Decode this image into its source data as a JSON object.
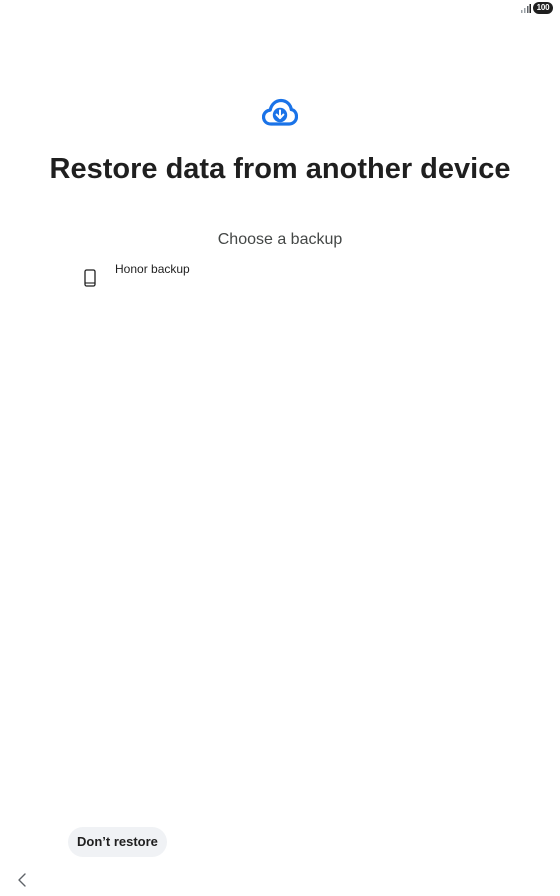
{
  "status_bar": {
    "signal_icon": "signal-bars-icon",
    "battery_level": "100"
  },
  "header": {
    "icon": "cloud-download-icon",
    "icon_color": "#1a73e8",
    "title": "Restore data from another device",
    "subtitle": "Choose a backup"
  },
  "backups": [
    {
      "icon": "phone-icon",
      "label": "Honor backup"
    }
  ],
  "footer": {
    "dont_restore_label": "Don’t restore",
    "back_icon": "chevron-left-icon"
  }
}
